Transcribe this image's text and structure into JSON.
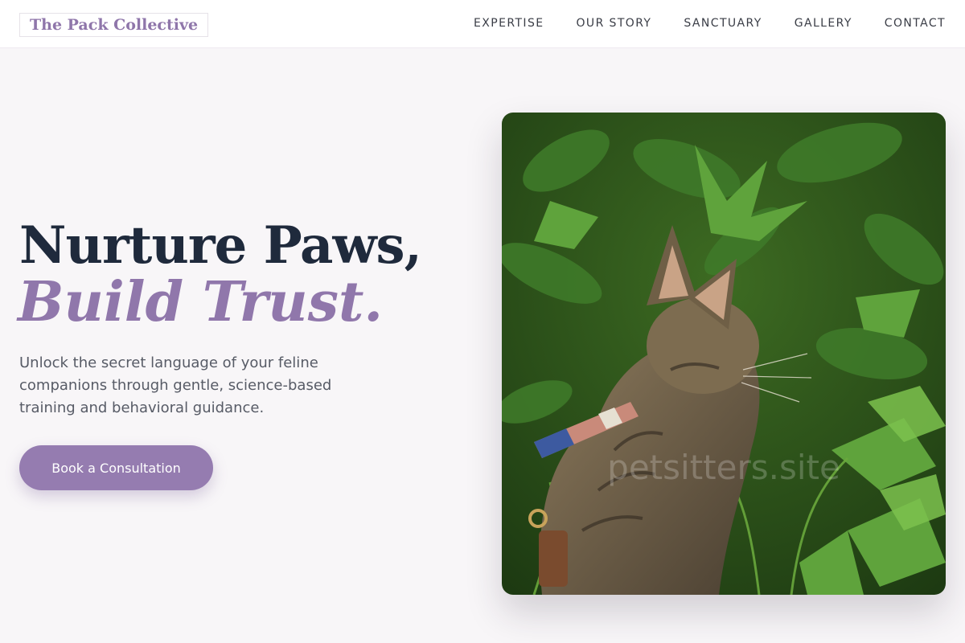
{
  "header": {
    "logo_text": "The Pack Collective",
    "nav": [
      {
        "label": "EXPERTISE"
      },
      {
        "label": "OUR STORY"
      },
      {
        "label": "SANCTUARY"
      },
      {
        "label": "GALLERY"
      },
      {
        "label": "CONTACT"
      }
    ]
  },
  "hero": {
    "title_line1": "Nurture Paws,",
    "title_line2": "Build Trust.",
    "subtitle": "Unlock the secret language of your feline companions through gentle, science-based training and behavioral guidance.",
    "cta_label": "Book a Consultation",
    "image": {
      "subject": "tabby cat with striped collar in green foliage",
      "watermark": "petsitters.site"
    }
  },
  "colors": {
    "accent": "#957cb0",
    "title": "#1f2a3c",
    "background": "#f8f6f8",
    "foliage": "#3f7a2a"
  }
}
